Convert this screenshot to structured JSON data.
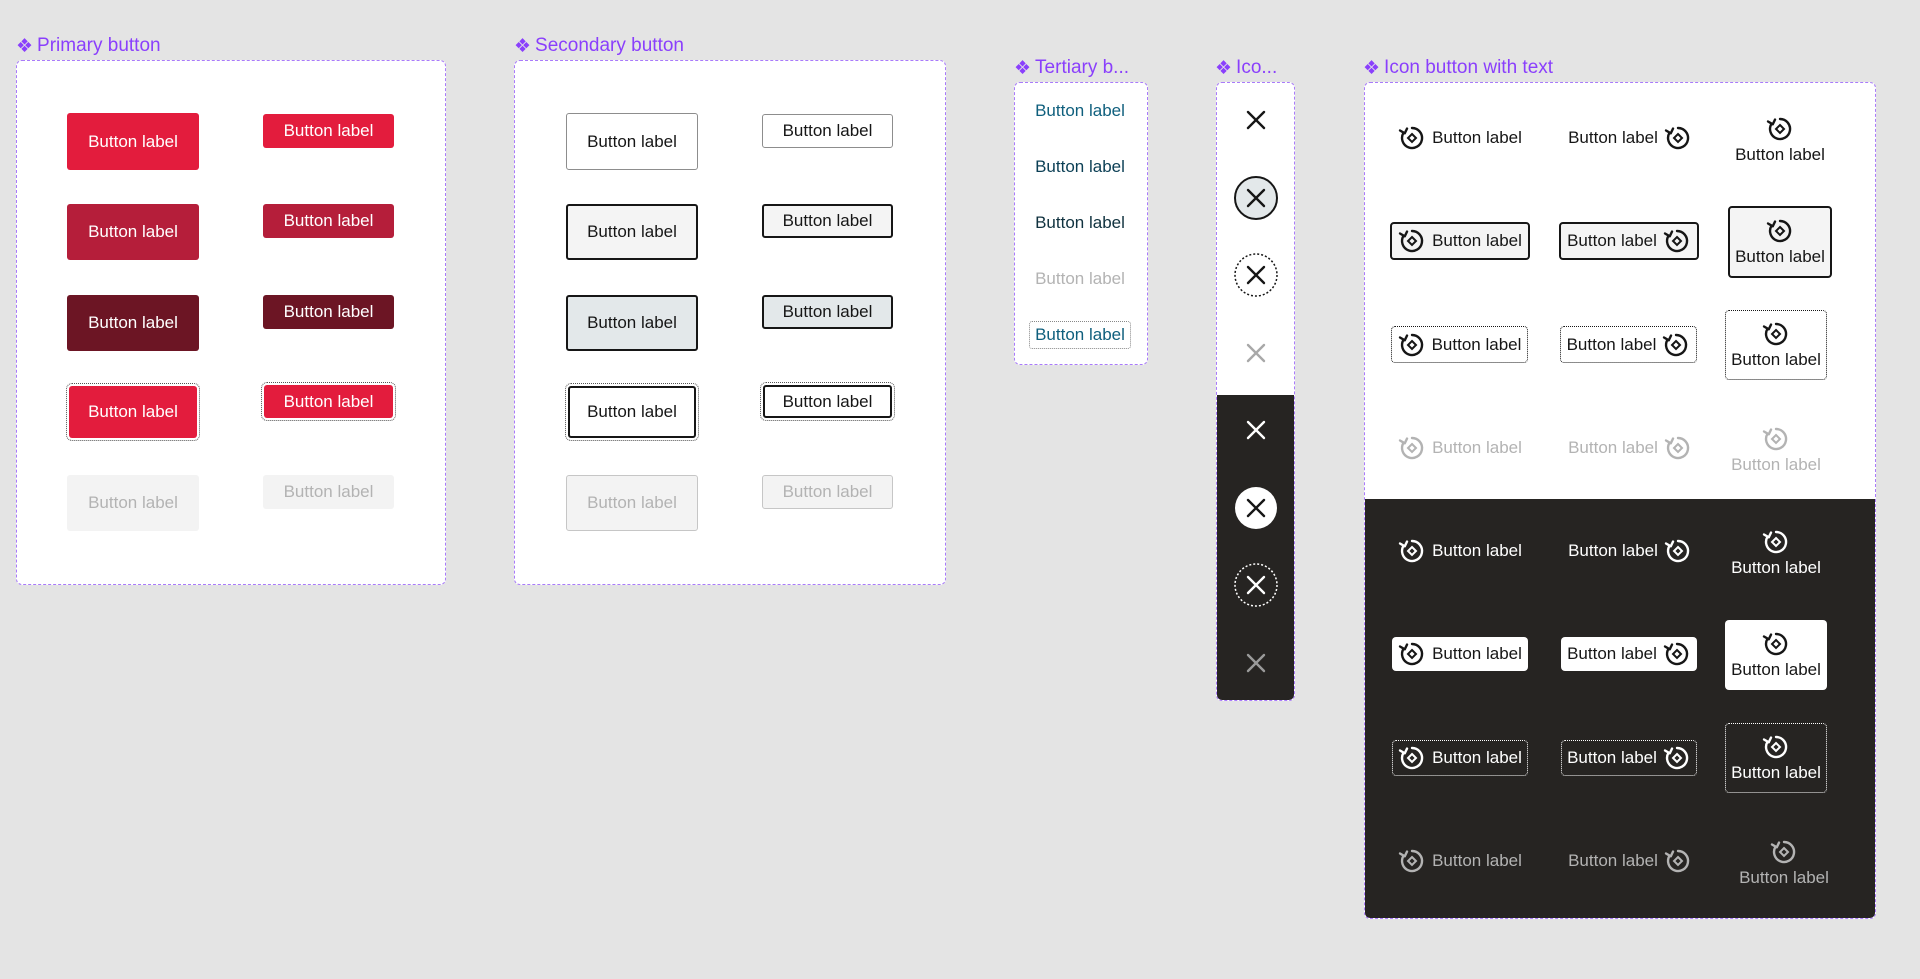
{
  "sections": {
    "primary": {
      "title": "Primary button"
    },
    "secondary": {
      "title": "Secondary button"
    },
    "tertiary": {
      "title": "Tertiary b..."
    },
    "icon": {
      "title": "Ico..."
    },
    "icon_text": {
      "title": "Icon button with text"
    }
  },
  "button_label": "Button label",
  "icons": {
    "section_marker": "component-diamond-icon",
    "close": "close-icon",
    "rotate": "rotate-icon"
  },
  "colors": {
    "title_purple": "#8a3ffc",
    "primary_red": "#e31c3d",
    "primary_hover": "#b51e3a",
    "primary_active": "#6c1524",
    "tertiary_blue": "#0f5f7d",
    "dark_bg": "#262422"
  }
}
